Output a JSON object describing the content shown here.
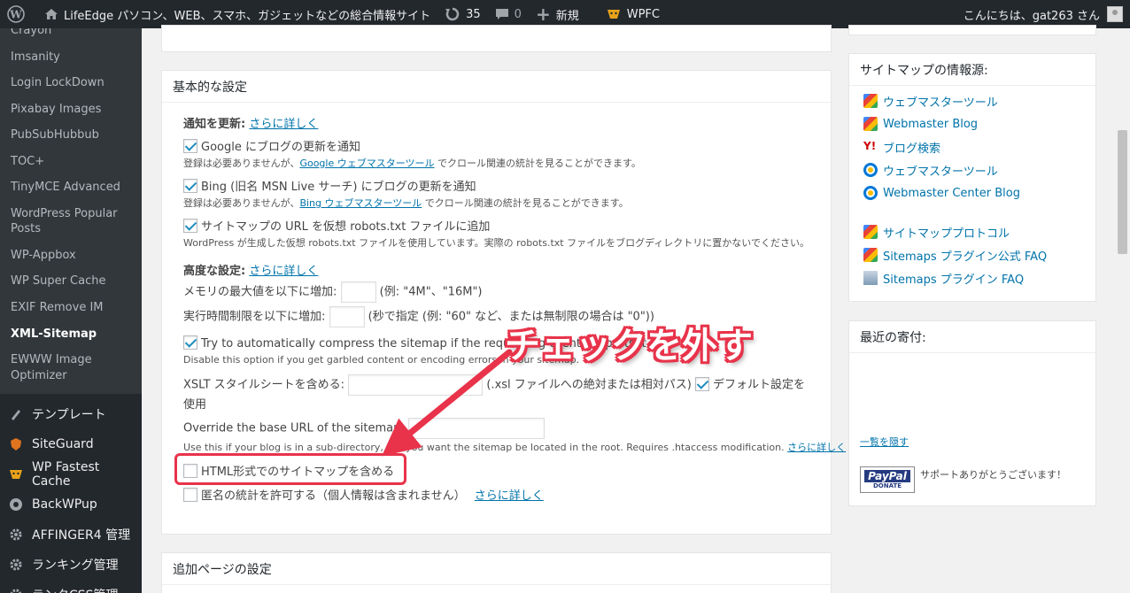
{
  "adminbar": {
    "site_name": "LifeEdge パソコン、WEB、スマホ、ガジェットなどの総合情報サイト",
    "updates_count": "35",
    "comments_count": "0",
    "new_label": "新規",
    "wpfc_label": "WPFC",
    "greeting": "こんにちは、gat263 さん"
  },
  "sidebar": {
    "submenu": [
      "Crayon",
      "Imsanity",
      "Login LockDown",
      "Pixabay Images",
      "PubSubHubbub",
      "TOC+",
      "TinyMCE Advanced",
      "WordPress Popular Posts",
      "WP-Appbox",
      "WP Super Cache",
      "EXIF Remove IM",
      "XML-Sitemap",
      "EWWW Image Optimizer"
    ],
    "current": "XML-Sitemap",
    "menu": [
      {
        "label": "テンプレート",
        "icon": "brush-icon"
      },
      {
        "label": "SiteGuard",
        "icon": "siteguard-icon"
      },
      {
        "label": "WP Fastest Cache",
        "icon": "cheetah-icon"
      },
      {
        "label": "BackWPup",
        "icon": "backwpup-icon"
      },
      {
        "label": "AFFINGER4 管理",
        "icon": "gear-icon"
      },
      {
        "label": "ランキング管理",
        "icon": "gear-icon"
      },
      {
        "label": "ランクCSS管理",
        "icon": "gear-icon"
      }
    ]
  },
  "basic": {
    "title": "基本的な設定",
    "notify_heading": "通知を更新:",
    "more_link": "さらに詳しく",
    "google_label": "Google にブログの更新を通知",
    "google_desc_pre": "登録は必要ありませんが、",
    "google_desc_link": "Google ウェブマスターツール",
    "google_desc_post": " でクロール関連の統計を見ることができます。",
    "bing_label": "Bing (旧名 MSN Live サーチ) にブログの更新を通知",
    "bing_desc_pre": "登録は必要ありませんが、",
    "bing_desc_link": "Bing ウェブマスターツール",
    "bing_desc_post": " でクロール関連の統計を見ることができます。",
    "robots_label": "サイトマップの URL を仮想 robots.txt ファイルに追加",
    "robots_desc": "WordPress が生成した仮想 robots.txt ファイルを使用しています。実際の robots.txt ファイルをブログディレクトリに置かないでください。",
    "advanced_heading": "高度な設定:",
    "memory_label": "メモリの最大値を以下に増加:",
    "memory_hint": "(例: \"4M\"、\"16M\")",
    "time_label": "実行時間制限を以下に増加:",
    "time_hint": "(秒で指定 (例: \"60\" など、または無制限の場合は \"0\"))",
    "compress_label": "Try to automatically compress the sitemap if the requesting client supports it.",
    "compress_desc": "Disable this option if you get garbled content or encoding errors in your sitemap.",
    "xslt_label": "XSLT スタイルシートを含める:",
    "xslt_hint": "(.xsl ファイルへの絶対または相対パス)",
    "xslt_default": "デフォルト設定を使用",
    "baseurl_label": "Override the base URL of the sitemap:",
    "baseurl_desc": "Use this if your blog is in a sub-directory, but you want the sitemap be located in the root. Requires .htaccess modification.",
    "html_label": "HTML形式でのサイトマップを含める",
    "anon_label": "匿名の統計を許可する（個人情報は含まれません）"
  },
  "additional": {
    "title": "追加ページの設定"
  },
  "sources": {
    "title": "サイトマップの情報源:",
    "links": [
      {
        "label": "ウェブマスターツール",
        "icon": "google-icon"
      },
      {
        "label": "Webmaster Blog",
        "icon": "google-icon"
      },
      {
        "label": "ブログ検索",
        "icon": "yahoo-icon"
      },
      {
        "label": "ウェブマスターツール",
        "icon": "bing-icon"
      },
      {
        "label": "Webmaster Center Blog",
        "icon": "bing-icon"
      },
      {
        "label": "サイトマッププロトコル",
        "icon": "google-icon"
      },
      {
        "label": "Sitemaps プラグイン公式 FAQ",
        "icon": "google-icon"
      },
      {
        "label": "Sitemaps プラグイン FAQ",
        "icon": "sitemap-icon"
      }
    ]
  },
  "donations": {
    "title": "最近の寄付:",
    "hide_link": "一覧を隠す",
    "paypal_text": "PayPal",
    "paypal_sub": "DONATE",
    "thanks": "サポートありがとうございます！"
  },
  "annotation": {
    "note": "チェックを外す"
  },
  "colors": {
    "accent": "#0073aa",
    "annotation": "#e8334a",
    "adminbar": "#23282d"
  }
}
